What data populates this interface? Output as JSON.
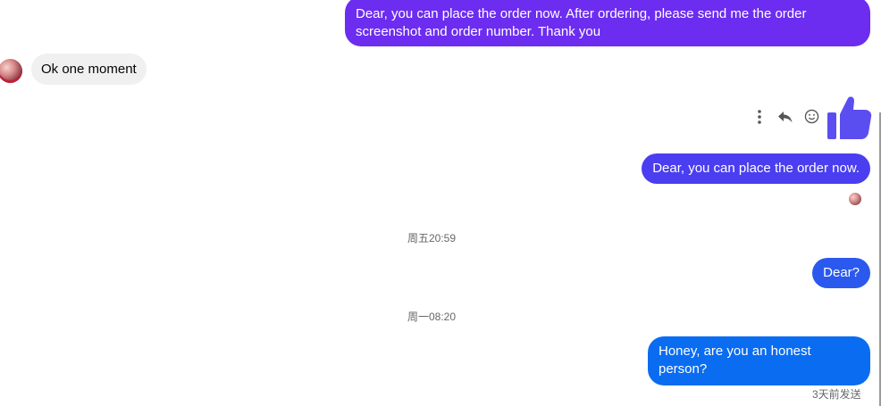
{
  "messages": [
    {
      "direction": "outgoing",
      "text": "Dear, you can place the order now. After ordering, please send me the order screenshot and order number. Thank you"
    },
    {
      "direction": "incoming",
      "text": "Ok one moment"
    },
    {
      "direction": "outgoing",
      "text": "Dear, you can place the order now."
    },
    {
      "direction": "outgoing",
      "text": "Dear?"
    },
    {
      "direction": "outgoing",
      "text": "Honey, are you an honest person?"
    }
  ],
  "timestamps": [
    "周五20:59",
    "周一08:20"
  ],
  "status_text": "3天前发送",
  "message_actions": {
    "icons": [
      "more-options-icon",
      "reply-icon",
      "emoji-icon"
    ]
  },
  "like_icon": "thumbs-up-icon",
  "colors": {
    "bubble_outgoing_1": "#6c2df0",
    "bubble_outgoing_2": "#4a3ef0",
    "bubble_outgoing_3": "#2b59ee",
    "bubble_outgoing_4": "#0a6cf0",
    "bubble_incoming": "#f0f0f0",
    "like": "#5b4ef0",
    "meta_text": "#65676b"
  }
}
